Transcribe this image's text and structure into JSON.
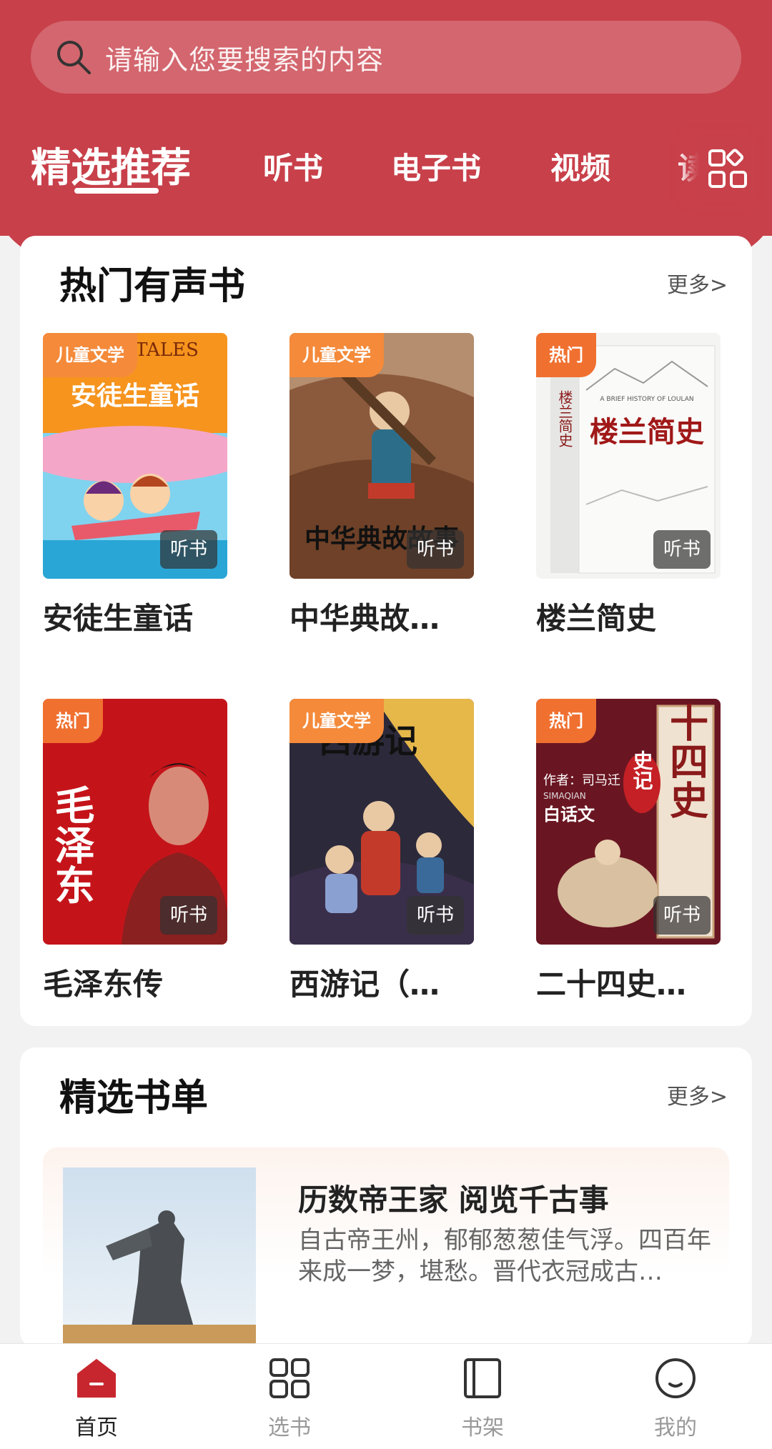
{
  "search": {
    "placeholder": "请输入您要搜索的内容",
    "icon": "search-icon"
  },
  "tabs": [
    "精选推荐",
    "听书",
    "电子书",
    "视频",
    "读"
  ],
  "hot": {
    "title": "热门有声书",
    "more": "更多>",
    "books": [
      {
        "title": "安徒生童话",
        "tag": "儿童文学",
        "badge": "听书"
      },
      {
        "title": "中华典故…",
        "tag": "儿童文学",
        "badge": "听书"
      },
      {
        "title": "楼兰简史",
        "tag": "热门",
        "badge": "听书"
      },
      {
        "title": "毛泽东传",
        "tag": "热门",
        "badge": "听书"
      },
      {
        "title": "西游记（…",
        "tag": "儿童文学",
        "badge": "听书"
      },
      {
        "title": "二十四史…",
        "tag": "热门",
        "badge": "听书"
      }
    ]
  },
  "covers": {
    "c1_title": "安徒生童话",
    "c1_sub": "FAIRY TALES",
    "c2_title": "中华典故故事",
    "c3_title": "楼兰简史",
    "c3_spine": "楼兰简史",
    "c3_en": "A BRIEF HISTORY OF LOULAN",
    "c4_title": "毛泽东",
    "c5_title": "西游记",
    "c6_title": "二十四史",
    "c6_seal": "史记",
    "c6_author": "作者：司马迁",
    "c6_pinyin": "SIMAQIAN",
    "c6_sub": "白话文"
  },
  "booklist": {
    "title": "精选书单",
    "more": "更多>",
    "item": {
      "title": "历数帝王家 阅览千古事",
      "desc": "自古帝王州，郁郁葱葱佳气浮。四百年来成一梦，堪愁。晋代衣冠成古…"
    }
  },
  "nav": [
    {
      "label": "首页",
      "icon": "home-icon",
      "active": true
    },
    {
      "label": "选书",
      "icon": "grid-icon",
      "active": false
    },
    {
      "label": "书架",
      "icon": "bookshelf-icon",
      "active": false
    },
    {
      "label": "我的",
      "icon": "profile-icon",
      "active": false
    }
  ],
  "colors": {
    "brand": "#c8404a",
    "tag": "#f48a3a",
    "hot_tag": "#f07030"
  }
}
